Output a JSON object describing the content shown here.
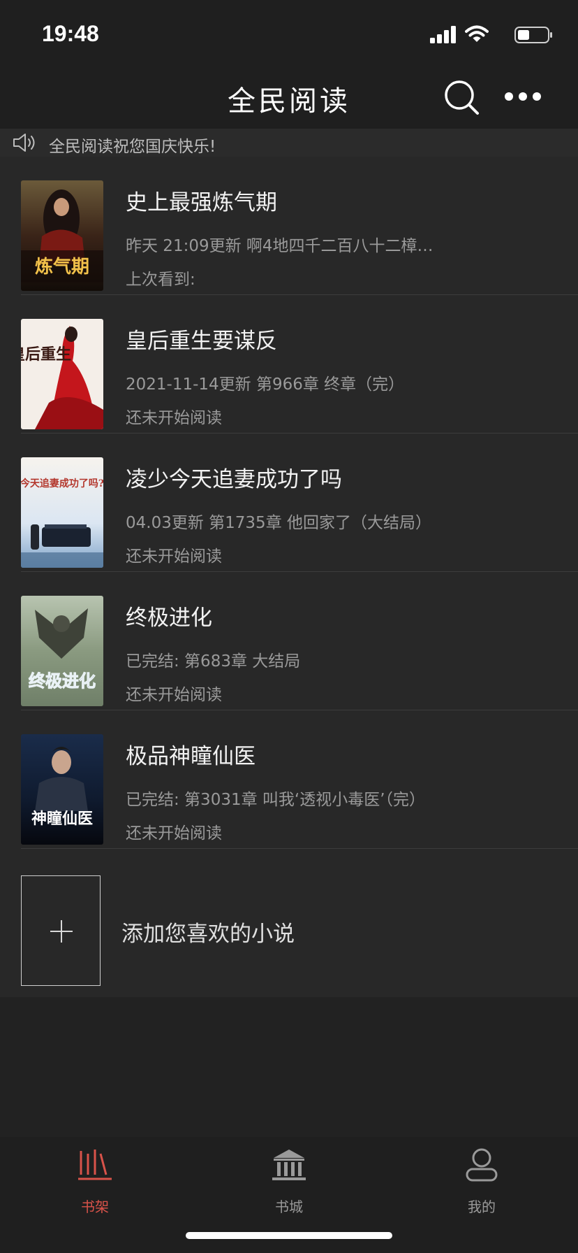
{
  "status": {
    "time": "19:48"
  },
  "header": {
    "title": "全民阅读",
    "search_icon": "search-icon",
    "more_icon": "more-icon"
  },
  "notice": {
    "text": "全民阅读祝您国庆快乐!",
    "icon": "speaker-icon"
  },
  "books": [
    {
      "title": "史上最强炼气期",
      "update": "昨天 21:09更新 啊4地四千二百八十二樟…",
      "progress": "上次看到:",
      "cover_text": "炼气期"
    },
    {
      "title": "皇后重生要谋反",
      "update": "2021-11-14更新 第966章 终章（完）",
      "progress": "还未开始阅读",
      "cover_text": "皇后重生"
    },
    {
      "title": "凌少今天追妻成功了吗",
      "update": "04.03更新 第1735章 他回家了（大结局）",
      "progress": "还未开始阅读",
      "cover_text": "今天追妻成功了吗?"
    },
    {
      "title": "终极进化",
      "update": "已完结: 第683章 大结局",
      "progress": "还未开始阅读",
      "cover_text": "终极进化"
    },
    {
      "title": "极品神瞳仙医",
      "update": "已完结: 第3031章 叫我‘透视小毒医’（完）",
      "progress": "还未开始阅读",
      "cover_text": "神瞳仙医"
    }
  ],
  "add_book": {
    "label": "添加您喜欢的小说"
  },
  "tabs": [
    {
      "label": "书架",
      "icon": "bookshelf-icon",
      "active": true
    },
    {
      "label": "书城",
      "icon": "bookstore-icon",
      "active": false
    },
    {
      "label": "我的",
      "icon": "profile-icon",
      "active": false
    }
  ],
  "colors": {
    "background": "#222222",
    "active_tab": "#d9534a",
    "inactive_tab": "#9a9a9a",
    "secondary_text": "#9a9a9a"
  }
}
